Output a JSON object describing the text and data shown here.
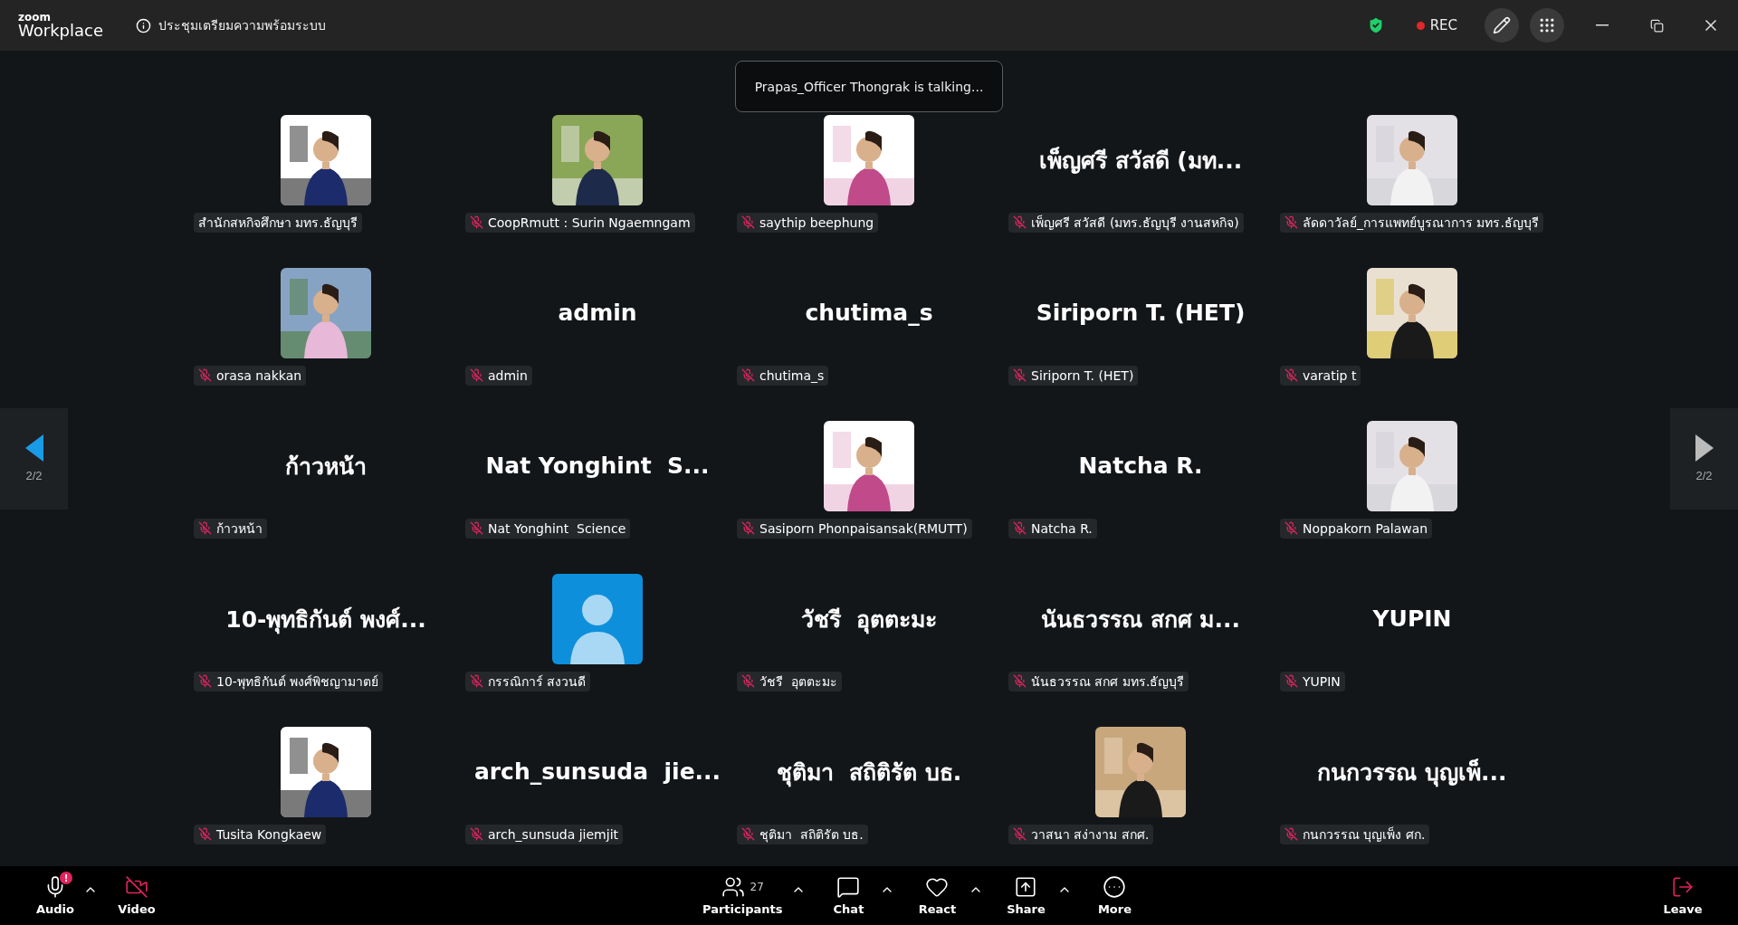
{
  "app": {
    "logo_top": "zoom",
    "logo_bottom": "Workplace"
  },
  "meeting": {
    "title": "ประชุมเตรียมความพร้อมระบบ"
  },
  "recording": {
    "label": "REC"
  },
  "toast": "Prapas_Officer Thongrak is talking...",
  "pager": {
    "left": "2/2",
    "right": "2/2"
  },
  "tiles": [
    {
      "kind": "picture",
      "name": "สำนักสหกิจศึกษา มทร.ธัญบุรี",
      "muted": false
    },
    {
      "kind": "picture",
      "name": "CoopRmutt : Surin Ngaemngam",
      "muted": true
    },
    {
      "kind": "picture",
      "name": "saythip beephung",
      "muted": true
    },
    {
      "kind": "name",
      "display": "เพ็ญศรี สวัสดี (มท...",
      "name": "เพ็ญศรี สวัสดี (มทร.ธัญบุรี งานสหกิจ)",
      "muted": true
    },
    {
      "kind": "picture",
      "name": "ลัดดาวัลย์_การแพทย์บูรณาการ มทร.ธัญบุรี",
      "muted": true
    },
    {
      "kind": "picture",
      "name": "orasa nakkan",
      "muted": true
    },
    {
      "kind": "name",
      "display": "admin",
      "name": "admin",
      "muted": true
    },
    {
      "kind": "name",
      "display": "chutima_s",
      "name": "chutima_s",
      "muted": true
    },
    {
      "kind": "name",
      "display": "Siriporn T. (HET)",
      "name": "Siriporn T. (HET)",
      "muted": true
    },
    {
      "kind": "picture",
      "name": "varatip t",
      "muted": true
    },
    {
      "kind": "name",
      "display": "ก้าวหน้า",
      "name": "ก้าวหน้า",
      "muted": true
    },
    {
      "kind": "name",
      "display": "Nat Yonghint  S...",
      "name": "Nat Yonghint  Science",
      "muted": true
    },
    {
      "kind": "picture",
      "name": "Sasiporn Phonpaisansak(RMUTT)",
      "muted": true
    },
    {
      "kind": "name",
      "display": "Natcha R.",
      "name": "Natcha R.",
      "muted": true
    },
    {
      "kind": "picture",
      "name": "Noppakorn Palawan",
      "muted": true
    },
    {
      "kind": "name",
      "display": "10-พุทธิกันต์ พงศ์...",
      "name": "10-พุทธิกันต์ พงศ์พิชญามาตย์",
      "muted": true
    },
    {
      "kind": "avatar",
      "name": "กรรณิการ์ สงวนดี",
      "muted": true
    },
    {
      "kind": "name",
      "display": "วัชรี  อุตตะมะ",
      "name": "วัชรี  อุตตะมะ",
      "muted": true
    },
    {
      "kind": "name",
      "display": "นันธวรรณ สกศ ม...",
      "name": "นันธวรรณ สกศ มทร.ธัญบุรี",
      "muted": true
    },
    {
      "kind": "name",
      "display": "YUPIN",
      "name": "YUPIN",
      "muted": true
    },
    {
      "kind": "picture",
      "name": "Tusita Kongkaew",
      "muted": true
    },
    {
      "kind": "name",
      "display": "arch_sunsuda  jie...",
      "name": "arch_sunsuda jiemjit",
      "muted": true
    },
    {
      "kind": "name",
      "display": "ชุติมา  สถิติรัต บธ.",
      "name": "ชุติมา  สถิติรัต บธ.",
      "muted": true
    },
    {
      "kind": "picture",
      "name": "วาสนา สง่างาม สกศ.",
      "muted": true
    },
    {
      "kind": "name",
      "display": "กนกวรรณ บุญเพ็...",
      "name": "กนกวรรณ บุญเพ็ง ศก.",
      "muted": true
    }
  ],
  "toolbar": [
    {
      "kind": "audio",
      "label": "Audio",
      "badge": "!",
      "caret": true
    },
    {
      "kind": "video",
      "label": "Video",
      "on": false
    },
    {
      "kind": "participants",
      "label": "Participants",
      "count": "27",
      "caret": true
    },
    {
      "kind": "chat",
      "label": "Chat",
      "caret": true
    },
    {
      "kind": "react",
      "label": "React",
      "caret": true
    },
    {
      "kind": "share",
      "label": "Share",
      "caret": true
    },
    {
      "kind": "more",
      "label": "More"
    },
    {
      "kind": "leave",
      "label": "Leave"
    }
  ]
}
